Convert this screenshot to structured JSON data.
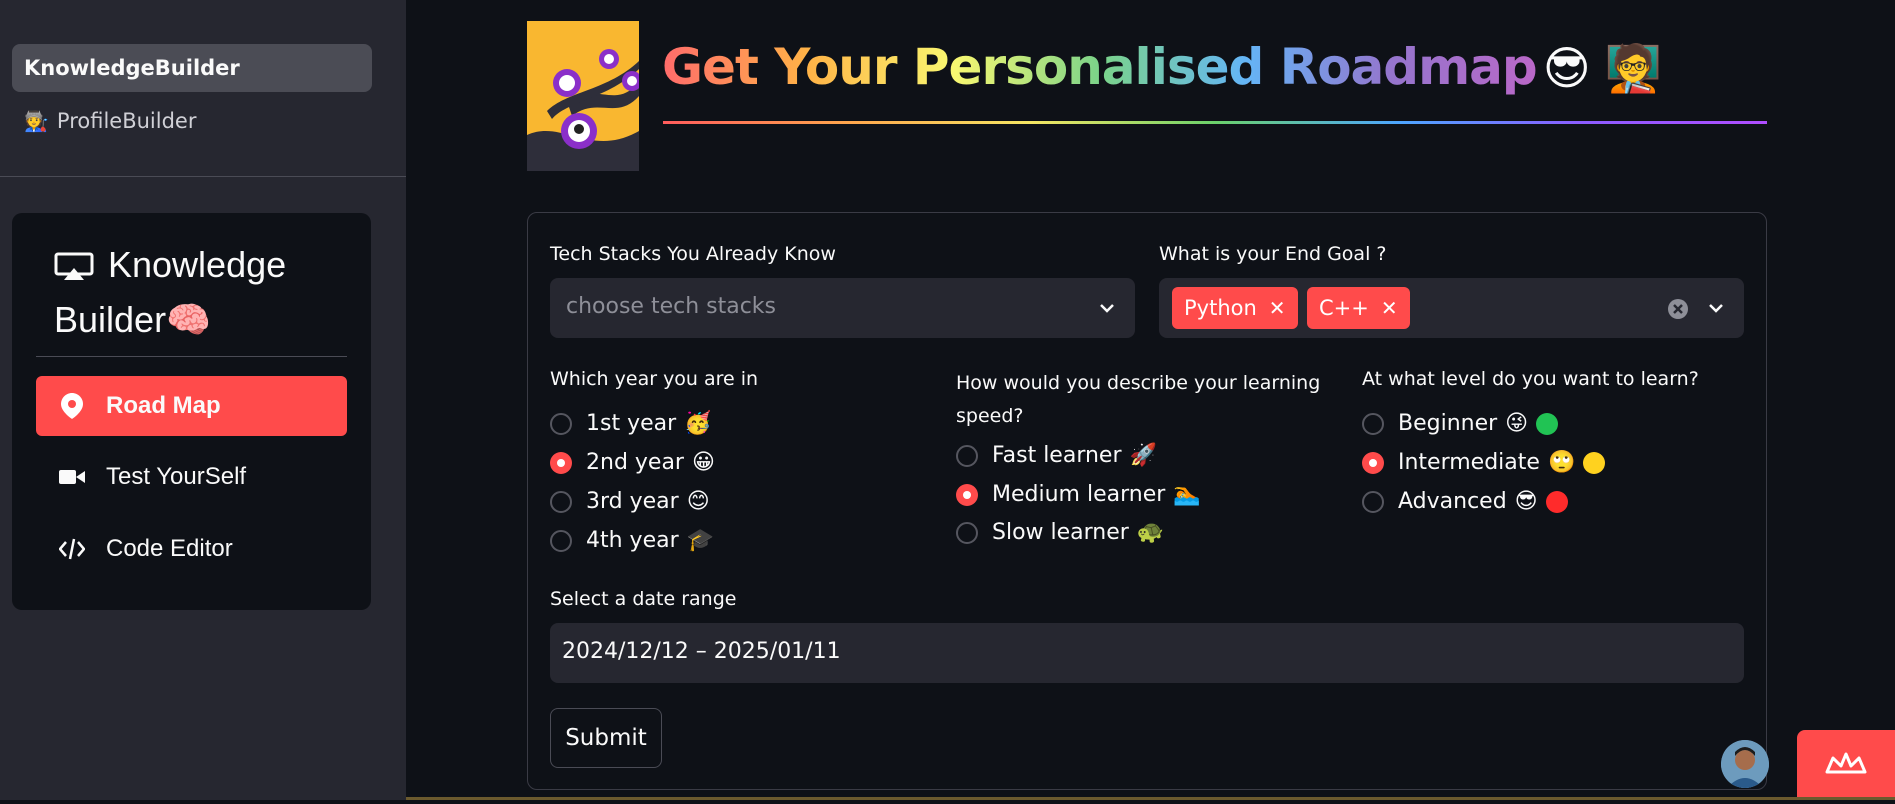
{
  "sidebar": {
    "pages": [
      {
        "label": "KnowledgeBuilder",
        "active": true
      },
      {
        "label": "ProfileBuilder",
        "active": false,
        "icon": "builder-emoji-icon"
      }
    ],
    "menu": {
      "title": "Knowledge Builder🧠",
      "items": [
        {
          "label": "Road Map",
          "icon": "map-pin-icon",
          "selected": true
        },
        {
          "label": "Test YourSelf",
          "icon": "video-camera-icon",
          "selected": false
        },
        {
          "label": "Code Editor",
          "icon": "code-icon",
          "selected": false
        }
      ]
    }
  },
  "header": {
    "title": "Get Your Personalised Roadmap",
    "title_emojis": "😎 🧑‍🏫"
  },
  "form": {
    "tech_stacks": {
      "label": "Tech Stacks You Already Know",
      "placeholder": "choose tech stacks"
    },
    "end_goal": {
      "label": "What is your End Goal ?",
      "tags": [
        "Python",
        "C++"
      ]
    },
    "year": {
      "label": "Which year you are in",
      "options": [
        {
          "label": "1st year",
          "emoji": "🥳"
        },
        {
          "label": "2nd year",
          "emoji": "😀"
        },
        {
          "label": "3rd year",
          "emoji": "😊"
        },
        {
          "label": "4th year",
          "emoji": "🎓"
        }
      ],
      "selected": "2nd year"
    },
    "speed": {
      "label": "How would you describe your learning speed?",
      "options": [
        {
          "label": "Fast learner",
          "emoji": "🚀"
        },
        {
          "label": "Medium learner",
          "emoji": "🏊"
        },
        {
          "label": "Slow learner",
          "emoji": "🐢"
        }
      ],
      "selected": "Medium learner"
    },
    "level": {
      "label": "At what level do you want to learn?",
      "options": [
        {
          "label": "Beginner",
          "emoji": "😜",
          "color": "#21c354"
        },
        {
          "label": "Intermediate",
          "emoji": "🙄",
          "color": "#ffd21f"
        },
        {
          "label": "Advanced",
          "emoji": "😎",
          "color": "#ff2b2b"
        }
      ],
      "selected": "Intermediate"
    },
    "date_range": {
      "label": "Select a date range",
      "value": "2024/12/12 – 2025/01/11"
    },
    "submit_label": "Submit"
  },
  "colors": {
    "accent": "#ff4b4b",
    "bg": "#0e1117",
    "sidebar": "#262730"
  }
}
